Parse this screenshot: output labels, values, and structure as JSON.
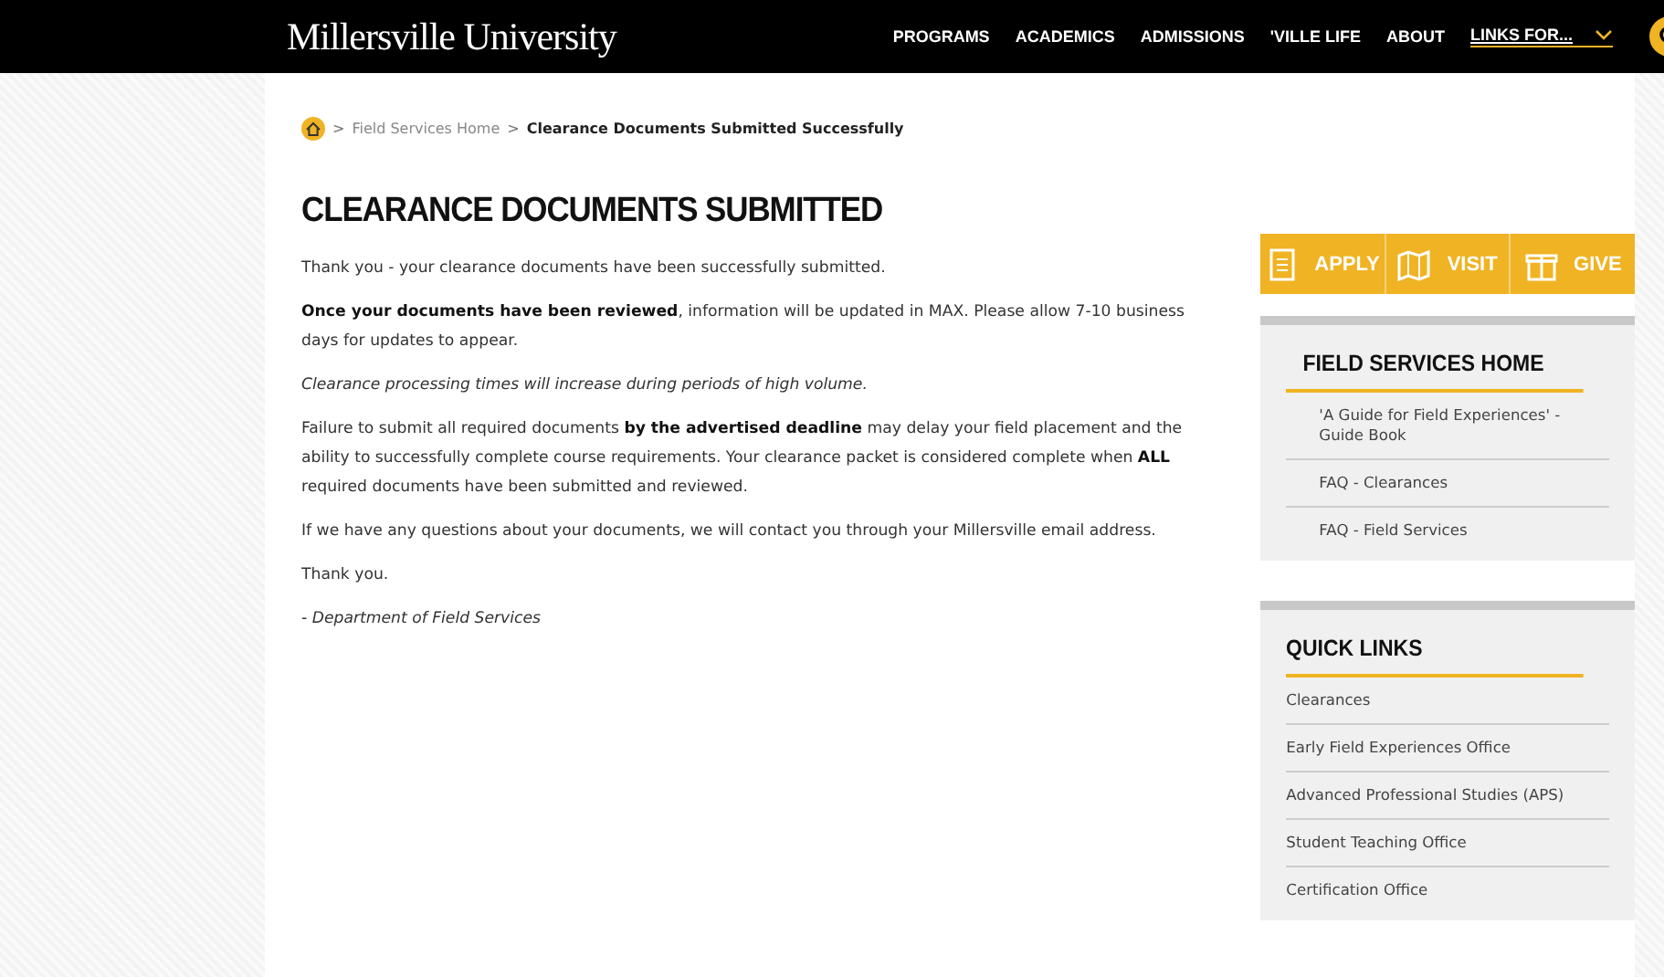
{
  "header": {
    "logo": "Millersville University",
    "nav": [
      {
        "label": "PROGRAMS",
        "kind": "link"
      },
      {
        "label": "ACADEMICS",
        "kind": "link"
      },
      {
        "label": "ADMISSIONS",
        "kind": "link"
      },
      {
        "label": "'VILLE LIFE",
        "kind": "link"
      },
      {
        "label": "ABOUT",
        "kind": "link"
      },
      {
        "label": "LINKS FOR...",
        "kind": "dropdown"
      }
    ]
  },
  "breadcrumb": {
    "separator": ">",
    "links": [
      "Field Services Home"
    ],
    "current": "Clearance Documents Submitted Successfully"
  },
  "title": "CLEARANCE DOCUMENTS SUBMITTED",
  "paragraphs": [
    {
      "text": "Thank you - your clearance documents have been successfully submitted.",
      "kind": "normal"
    },
    {
      "text": "**Once your documents have been reviewed**, information will be updated in MAX.  Please allow 7-10 business days for updates to appear.",
      "kind": "normal"
    },
    {
      "text": "Clearance processing times will increase during periods of high volume.",
      "kind": "italic"
    },
    {
      "text": "Failure to submit all required documents **by the advertised deadline** may delay your field placement and the ability to successfully complete course requirements.   Your clearance packet is considered complete when **ALL** required documents have been submitted and reviewed.",
      "kind": "normal"
    },
    {
      "text": "If we have any questions about your documents, we will contact you through your Millersville email address.",
      "kind": "normal"
    },
    {
      "text": "Thank you.",
      "kind": "normal"
    },
    {
      "text": "- Department of Field Services",
      "kind": "italic"
    }
  ],
  "actions": [
    {
      "label": "APPLY",
      "kind": "form"
    },
    {
      "label": "VISIT",
      "kind": "map"
    },
    {
      "label": "GIVE",
      "kind": "gift"
    }
  ],
  "panels": [
    {
      "title": "FIELD SERVICES HOME",
      "items": [
        "'A Guide for Field Experiences' - Guide Book",
        "FAQ - Clearances",
        "FAQ - Field Services"
      ]
    },
    {
      "title": "QUICK LINKS",
      "items": [
        "Clearances",
        "Early Field Experiences Office",
        "Advanced Professional Studies (APS)",
        "Student Teaching Office",
        "Certification Office"
      ]
    }
  ]
}
